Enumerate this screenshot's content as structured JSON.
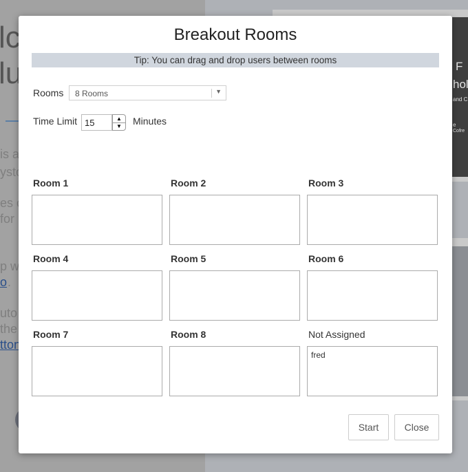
{
  "background": {
    "big_fragments": [
      "lc",
      "lu"
    ],
    "text_fragments": [
      "is a",
      "ysto",
      "es c",
      "for",
      "p w",
      ".",
      "uto",
      "the"
    ],
    "link_fragments": [
      "o",
      "tton"
    ],
    "right_fragments": [
      "F",
      "hol",
      "and C",
      "e",
      "Cofre"
    ]
  },
  "modal": {
    "title": "Breakout Rooms",
    "tip": "Tip: You can drag and drop users between rooms",
    "rooms_label": "Rooms",
    "rooms_value": "8 Rooms",
    "time_limit_label": "Time Limit",
    "time_limit_value": "15",
    "minutes_label": "Minutes",
    "rooms": [
      {
        "name": "Room 1",
        "users": []
      },
      {
        "name": "Room 2",
        "users": []
      },
      {
        "name": "Room 3",
        "users": []
      },
      {
        "name": "Room 4",
        "users": []
      },
      {
        "name": "Room 5",
        "users": []
      },
      {
        "name": "Room 6",
        "users": []
      },
      {
        "name": "Room 7",
        "users": []
      },
      {
        "name": "Room 8",
        "users": []
      },
      {
        "name": "Not Assigned",
        "users": [
          "fred"
        ]
      }
    ],
    "start_label": "Start",
    "close_label": "Close"
  }
}
